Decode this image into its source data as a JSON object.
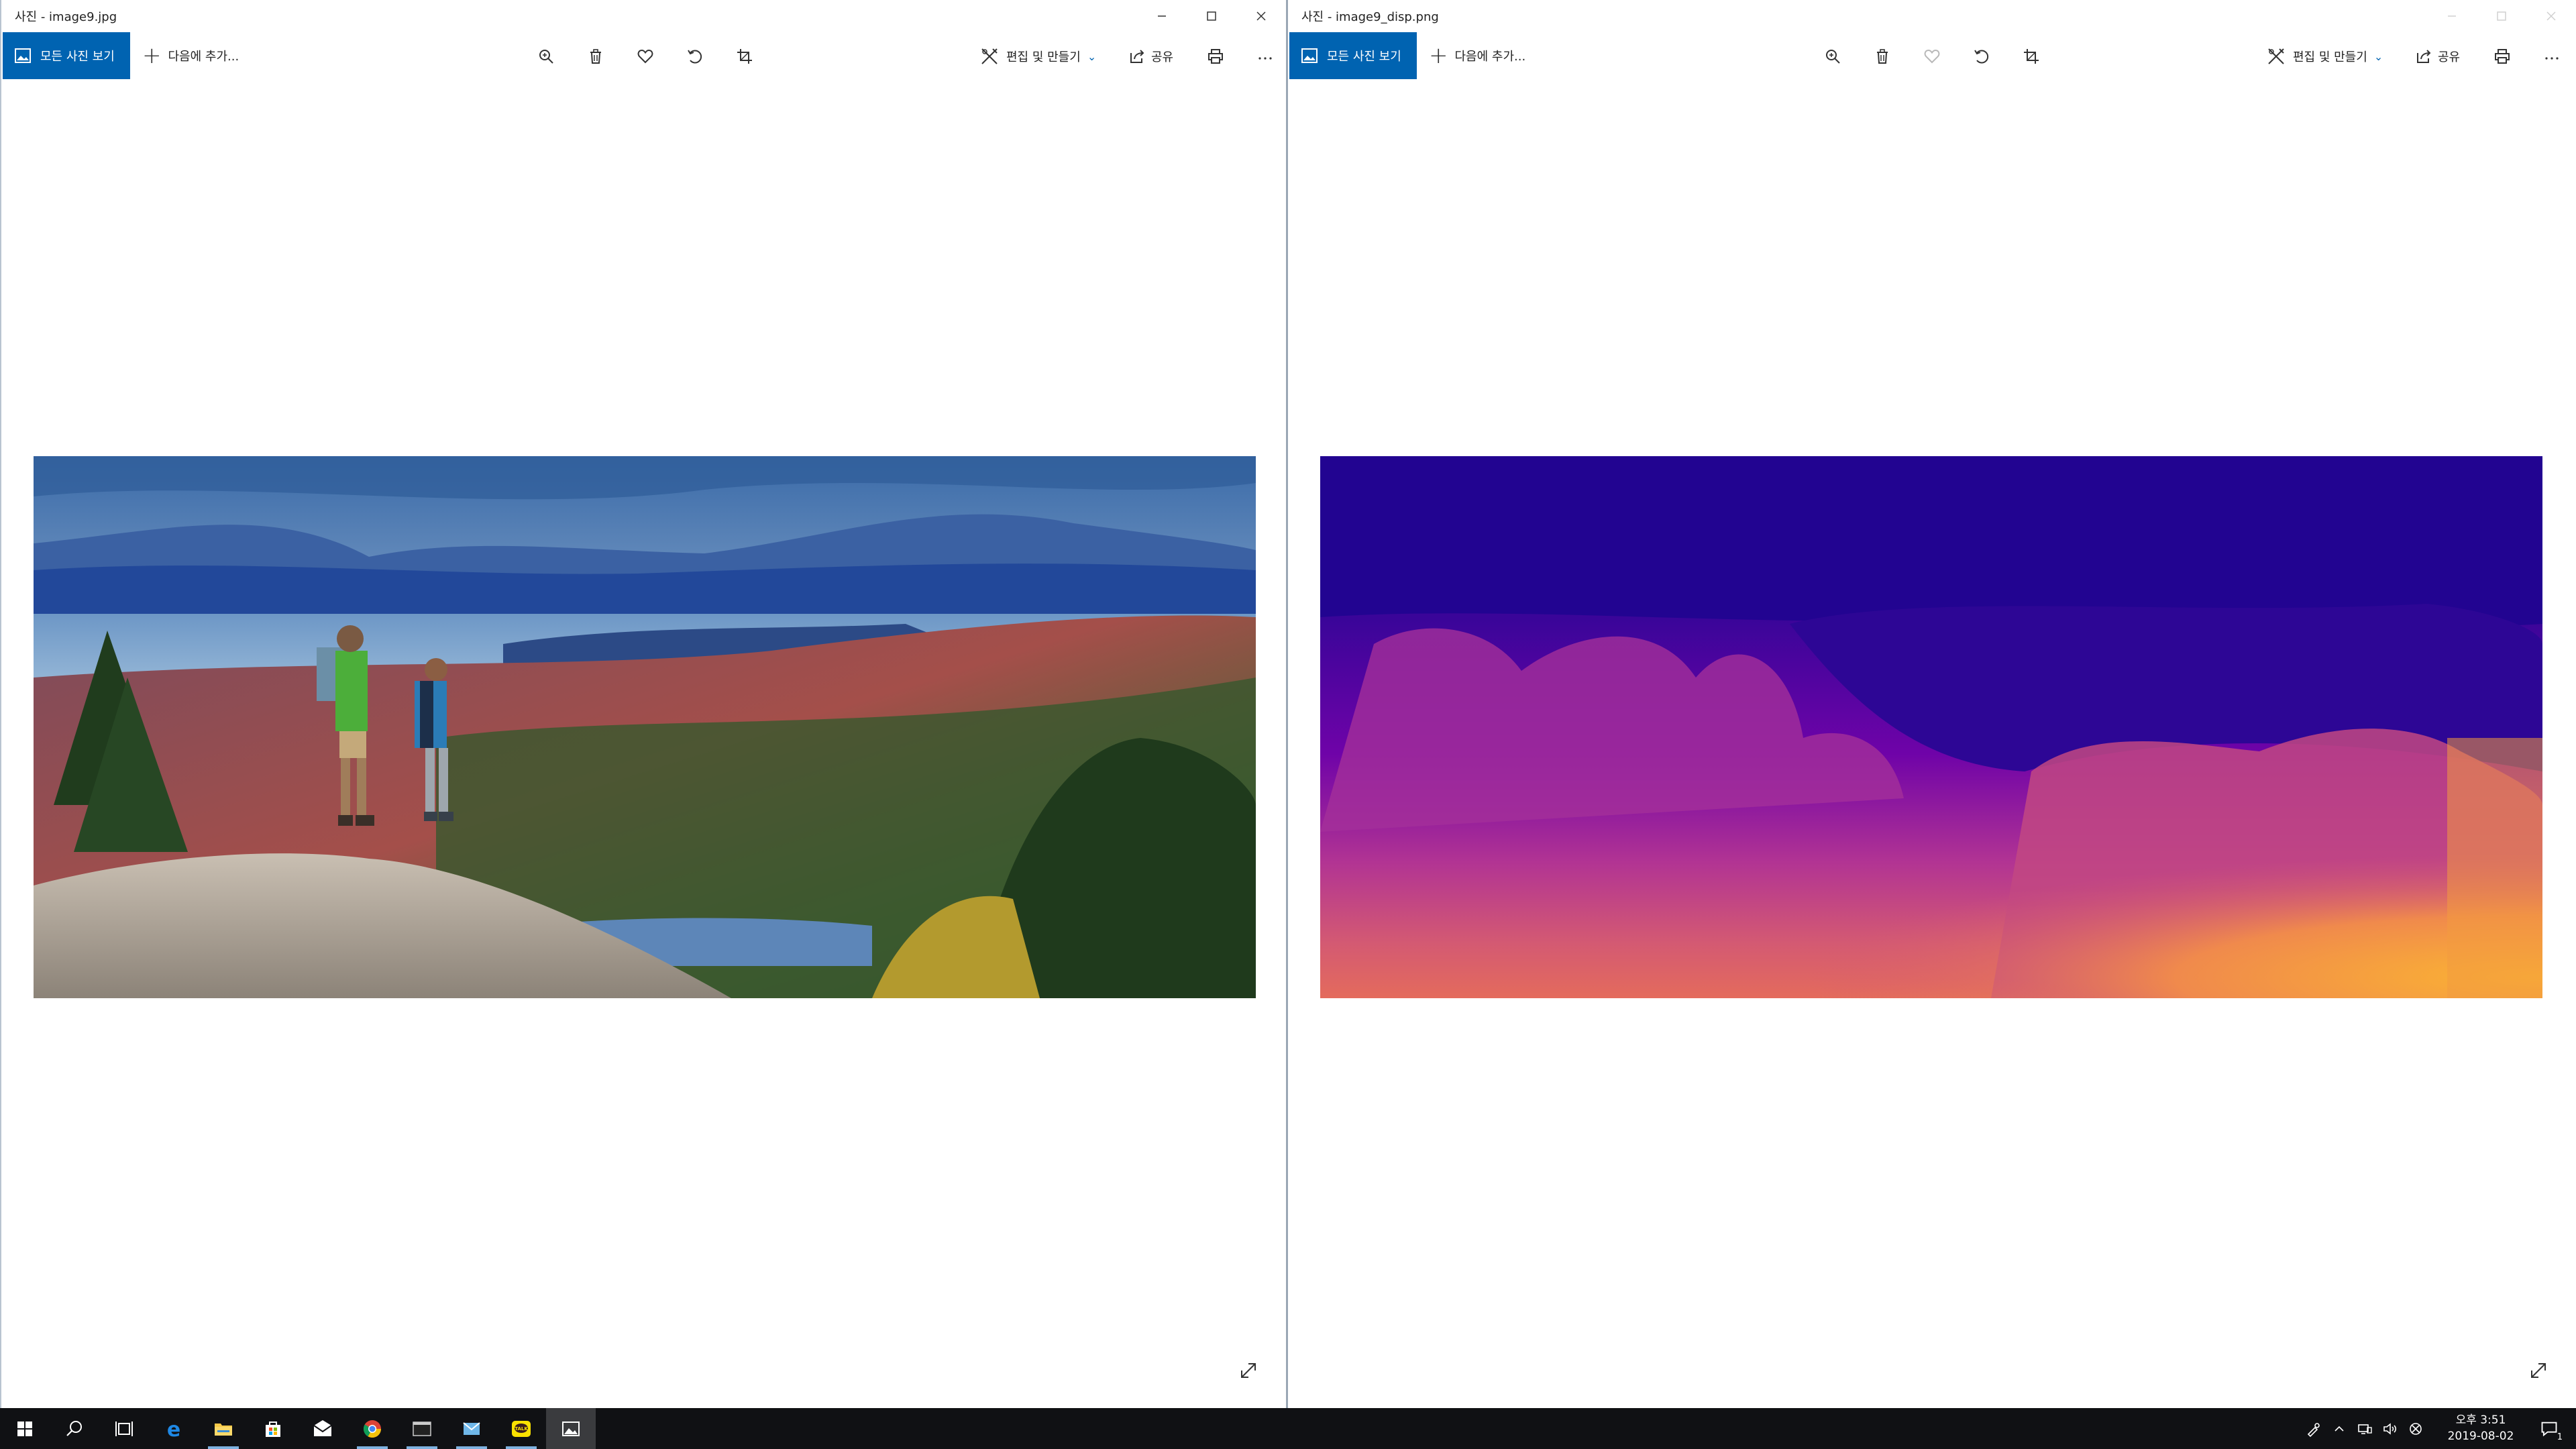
{
  "windows": [
    {
      "title": "사진 - image9.jpg",
      "toolbar": {
        "all_photos": "모든 사진 보기",
        "add_to": "다음에 추가...",
        "edit_create": "편집 및 만들기",
        "share": "공유"
      },
      "image": "Hikers on rocky summit overlooking lake, autumn forest and mountains",
      "favorite_enabled": true
    },
    {
      "title": "사진 - image9_disp.png",
      "toolbar": {
        "all_photos": "모든 사진 보기",
        "add_to": "다음에 추가...",
        "edit_create": "편집 및 만들기",
        "share": "공유"
      },
      "image": "Disparity map rendered with plasma colormap (dark purple far, yellow near)",
      "favorite_enabled": false
    }
  ],
  "taskbar": {
    "apps": [
      "start-icon",
      "search-icon",
      "task-view-icon",
      "edge-icon",
      "file-explorer-icon",
      "store-icon",
      "mail-icon",
      "chrome-icon",
      "terminal-icon",
      "outlook-icon",
      "kakaotalk-icon",
      "photos-icon"
    ],
    "clock_time": "오후 3:51",
    "clock_date": "2019-08-02",
    "notification_count": "1"
  },
  "colors": {
    "accent": "#0063b1",
    "taskbar_bg": "#101114",
    "plasma": [
      "#0d0887",
      "#5302a3",
      "#8b0aa5",
      "#b83289",
      "#db5c68",
      "#f48849",
      "#febd2a",
      "#f0f921"
    ]
  }
}
